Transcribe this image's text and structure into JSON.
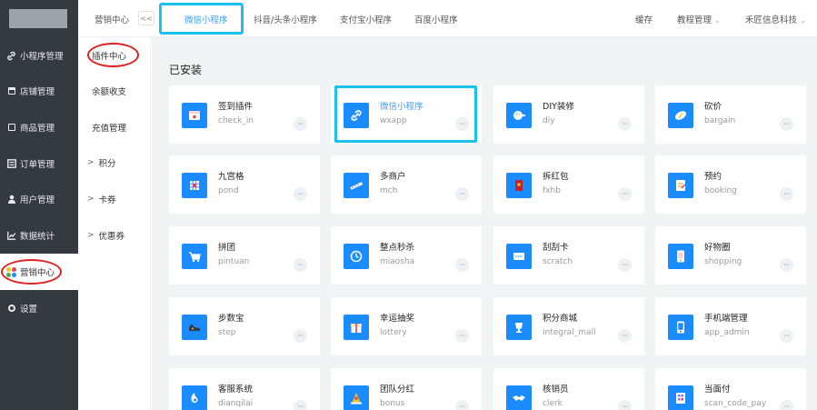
{
  "sidebar": {
    "items": [
      {
        "label": "小程序管理",
        "icon": "link-icon"
      },
      {
        "label": "店铺管理",
        "icon": "store-icon"
      },
      {
        "label": "商品管理",
        "icon": "box-icon"
      },
      {
        "label": "订单管理",
        "icon": "list-icon"
      },
      {
        "label": "用户管理",
        "icon": "user-icon"
      },
      {
        "label": "数据统计",
        "icon": "chart-icon"
      },
      {
        "label": "营销中心",
        "icon": "palette-icon"
      },
      {
        "label": "设置",
        "icon": "gear-icon"
      }
    ]
  },
  "subnav": {
    "items": [
      {
        "label": "插件中心",
        "arrow": ""
      },
      {
        "label": "余额收支",
        "arrow": ""
      },
      {
        "label": "充值管理",
        "arrow": ""
      },
      {
        "label": "积分",
        "arrow": ">"
      },
      {
        "label": "卡券",
        "arrow": ">"
      },
      {
        "label": "优惠券",
        "arrow": ">"
      }
    ]
  },
  "topbar": {
    "module_title": "营销中心",
    "collapse_label": "<<",
    "platform_tabs": [
      "微信小程序",
      "抖音/头条小程序",
      "支付宝小程序",
      "百度小程序"
    ],
    "cache_label": "缓存",
    "tutorial_label": "教程管理",
    "company_label": "禾匠信息科技",
    "caret": "⌄"
  },
  "content": {
    "section_title": "已安装",
    "more_label": "···",
    "plugins": [
      {
        "name": "签到插件",
        "key": "check_in",
        "color": "#e8404f",
        "icon": "calendar-icon"
      },
      {
        "name": "微信小程序",
        "key": "wxapp",
        "color": "#1a8cff",
        "icon": "link-icon"
      },
      {
        "name": "DIY装修",
        "key": "diy",
        "color": "#5ac8fa",
        "icon": "brush-icon"
      },
      {
        "name": "砍价",
        "key": "bargain",
        "color": "#f5c518",
        "icon": "pill-icon"
      },
      {
        "name": "九宫格",
        "key": "pond",
        "color": "#6b7fd7",
        "icon": "grid-icon"
      },
      {
        "name": "多商户",
        "key": "mch",
        "color": "#7b8cff",
        "icon": "shop-icon"
      },
      {
        "name": "拆红包",
        "key": "fxhb",
        "color": "#e8404f",
        "icon": "redpacket-icon"
      },
      {
        "name": "预约",
        "key": "booking",
        "color": "#f0a020",
        "icon": "booking-icon"
      },
      {
        "name": "拼团",
        "key": "pintuan",
        "color": "#f05030",
        "icon": "cart-icon"
      },
      {
        "name": "整点秒杀",
        "key": "miaosha",
        "color": "#2a6fe0",
        "icon": "clock-icon"
      },
      {
        "name": "刮刮卡",
        "key": "scratch",
        "color": "#3aa8f0",
        "icon": "ticket-icon"
      },
      {
        "name": "好物圈",
        "key": "shopping",
        "color": "#4cb050",
        "icon": "phone-icon"
      },
      {
        "name": "步数宝",
        "key": "step",
        "color": "#f5c518",
        "icon": "shoe-icon"
      },
      {
        "name": "幸运抽奖",
        "key": "lottery",
        "color": "#f08020",
        "icon": "gift-icon"
      },
      {
        "name": "积分商城",
        "key": "integral_mall",
        "color": "#3ac0a0",
        "icon": "trophy-icon"
      },
      {
        "name": "手机端管理",
        "key": "app_admin",
        "color": "#333a48",
        "icon": "mobile-icon"
      },
      {
        "name": "客服系统",
        "key": "dianqilai",
        "color": "#1a8cff",
        "icon": "service-icon"
      },
      {
        "name": "团队分红",
        "key": "bonus",
        "color": "#f0a020",
        "icon": "team-icon"
      },
      {
        "name": "核销员",
        "key": "clerk",
        "color": "#5a70e0",
        "icon": "handshake-icon"
      },
      {
        "name": "当面付",
        "key": "scan_code_pay",
        "color": "#8a6fe0",
        "icon": "pay-icon"
      }
    ]
  }
}
